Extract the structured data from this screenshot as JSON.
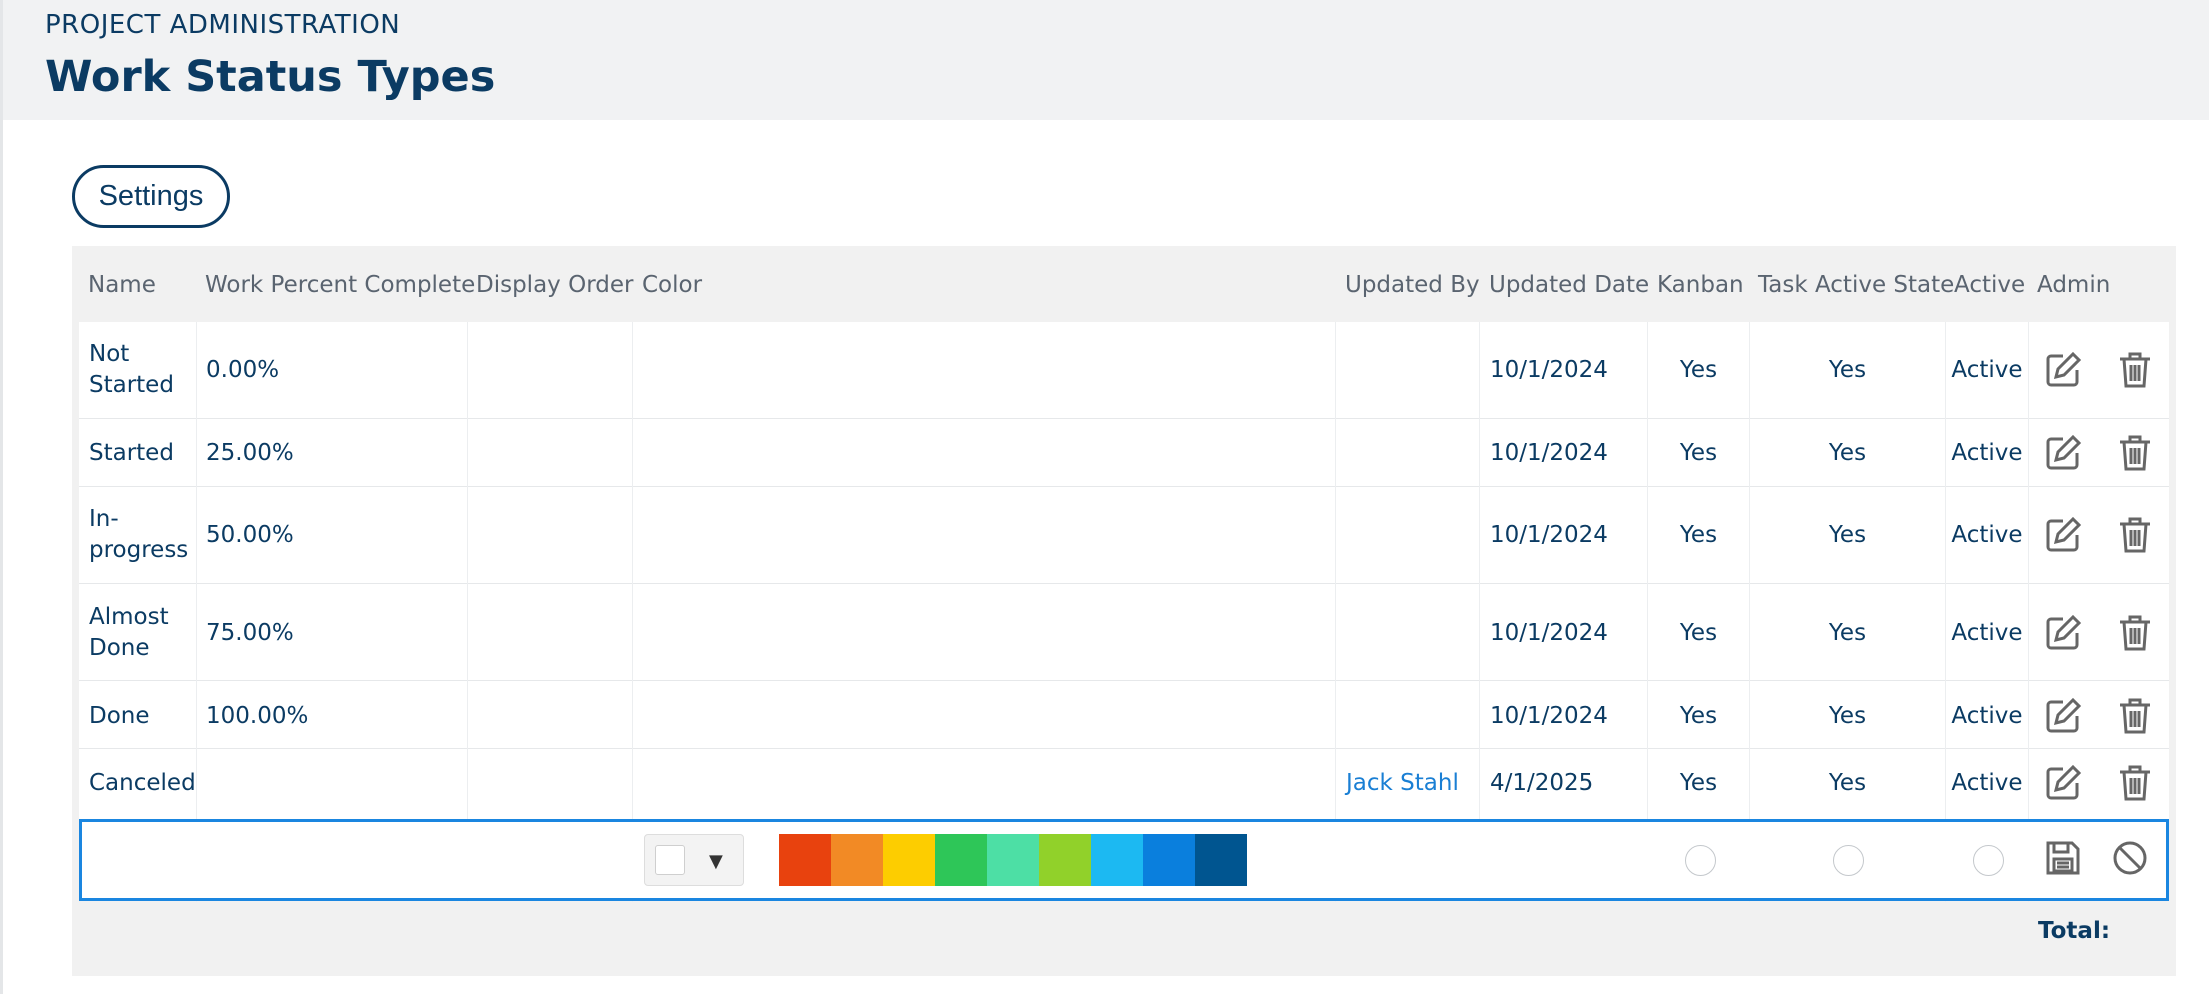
{
  "header": {
    "section": "PROJECT ADMINISTRATION",
    "title": "Work Status Types"
  },
  "settings_label": "Settings",
  "columns": {
    "name": "Name",
    "work_percent": "Work Percent Complete",
    "display_order": "Display Order",
    "color": "Color",
    "updated_by": "Updated By",
    "updated_date": "Updated Date",
    "kanban": "Kanban",
    "task_active_state": "Task Active State",
    "active": "Active",
    "admin": "Admin"
  },
  "rows": [
    {
      "name_line1": "Not",
      "name_line2": "Started",
      "percent": "0.00%",
      "updated_by": "",
      "updated_date": "10/1/2024",
      "kanban": "Yes",
      "task_active": "Yes",
      "active": "Active"
    },
    {
      "name_line1": "Started",
      "name_line2": "",
      "percent": "25.00%",
      "updated_by": "",
      "updated_date": "10/1/2024",
      "kanban": "Yes",
      "task_active": "Yes",
      "active": "Active"
    },
    {
      "name_line1": "In-",
      "name_line2": "progress",
      "percent": "50.00%",
      "updated_by": "",
      "updated_date": "10/1/2024",
      "kanban": "Yes",
      "task_active": "Yes",
      "active": "Active"
    },
    {
      "name_line1": "Almost",
      "name_line2": "Done",
      "percent": "75.00%",
      "updated_by": "",
      "updated_date": "10/1/2024",
      "kanban": "Yes",
      "task_active": "Yes",
      "active": "Active"
    },
    {
      "name_line1": "Done",
      "name_line2": "",
      "percent": "100.00%",
      "updated_by": "",
      "updated_date": "10/1/2024",
      "kanban": "Yes",
      "task_active": "Yes",
      "active": "Active"
    },
    {
      "name_line1": "Canceled",
      "name_line2": "",
      "percent": "",
      "updated_by": "Jack Stahl",
      "updated_date": "4/1/2025",
      "kanban": "Yes",
      "task_active": "Yes",
      "active": "Active"
    }
  ],
  "icons": {
    "edit": "edit-icon",
    "delete": "trash-icon",
    "save": "save-icon",
    "cancel": "cancel-icon",
    "dropdown": "caret-down-icon"
  },
  "palette": [
    "#e8420e",
    "#f28a25",
    "#fdcd00",
    "#2ec658",
    "#4ddfa5",
    "#91d12a",
    "#1cb9f2",
    "#0a7fdd",
    "#005590"
  ],
  "selected_color": "#ffffff",
  "footer": {
    "total_label": "Total:"
  },
  "colors": {
    "primary": "#0b3b63",
    "link": "#1a7fd4",
    "accent_border": "#1a86e0"
  }
}
